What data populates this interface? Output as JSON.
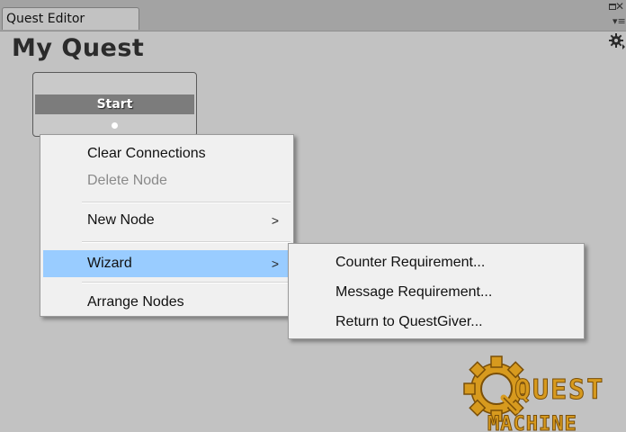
{
  "window": {
    "tab_label": "Quest Editor"
  },
  "editor": {
    "title": "My Quest",
    "node": {
      "title": "Start"
    }
  },
  "context_menu": {
    "items": [
      {
        "label": "Clear Connections",
        "enabled": true
      },
      {
        "label": "Delete Node",
        "enabled": false
      },
      {
        "label": "New Node",
        "enabled": true,
        "has_submenu": true,
        "arrow": ">"
      },
      {
        "label": "Wizard",
        "enabled": true,
        "has_submenu": true,
        "arrow": ">",
        "highlighted": true
      },
      {
        "label": "Arrange Nodes",
        "enabled": true
      }
    ]
  },
  "wizard_submenu": {
    "items": [
      {
        "label": "Counter Requirement..."
      },
      {
        "label": "Message Requirement..."
      },
      {
        "label": "Return to QuestGiver..."
      }
    ]
  },
  "logo": {
    "line1": "QUEST",
    "line2": "MACHINE"
  },
  "colors": {
    "background": "#c2c2c2",
    "menu_highlight": "#99ccff",
    "node_header": "#7c7c7c",
    "logo_gold": "#d79a1e"
  }
}
